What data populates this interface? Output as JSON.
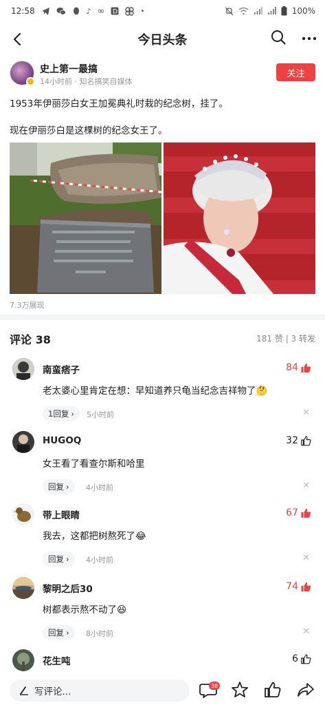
{
  "status_bar": {
    "time": "12:58",
    "battery": "100%",
    "app_icons": [
      "telegram-icon",
      "wechat-icon",
      "qq-icon",
      "tiktok-icon",
      "infinity-icon",
      "d-icon",
      "pinwheel-icon",
      "dot-icon"
    ]
  },
  "nav": {
    "title": "今日头条"
  },
  "author": {
    "name": "史上第一最搞",
    "meta": "14小时前 · 知名搞笑自媒体",
    "follow_label": "关注"
  },
  "post": {
    "line1": "1953年伊丽莎白女王加冕典礼时栽的纪念树，挂了。",
    "line2": "现在伊丽莎白是这棵树的纪念女王了。",
    "views": "7.3万展现"
  },
  "comments_header": {
    "title": "评论 38",
    "stats": "181 赞 | 3 转发"
  },
  "comments": [
    {
      "name": "南蛮痞子",
      "likes": "84",
      "liked": true,
      "text": "老太婆心里肯定在想：早知道养只龟当纪念吉祥物了",
      "reply": "1回复",
      "time": "5小时前",
      "emoji": "🤔"
    },
    {
      "name": "HUGOQ",
      "likes": "32",
      "liked": false,
      "text": "女王看了看查尔斯和哈里",
      "reply": "回复",
      "time": "4小时前",
      "emoji": ""
    },
    {
      "name": "带上眼睛",
      "likes": "67",
      "liked": true,
      "text": "我去，这都把树熬死了",
      "reply": "回复",
      "time": "4小时前",
      "emoji": "😂"
    },
    {
      "name": "黎明之后30",
      "likes": "74",
      "liked": true,
      "text": "树都表示熬不动了",
      "reply": "回复",
      "time": "8小时前",
      "emoji": "😆"
    },
    {
      "name": "花生吨",
      "likes": "6",
      "liked": false,
      "text": "",
      "reply": "",
      "time": "",
      "emoji": ""
    }
  ],
  "bottom_bar": {
    "input_placeholder": "写评论...",
    "comment_count_badge": "38"
  },
  "colors": {
    "accent_red": "#f04142",
    "text_primary": "#222222",
    "text_secondary": "#999999"
  }
}
